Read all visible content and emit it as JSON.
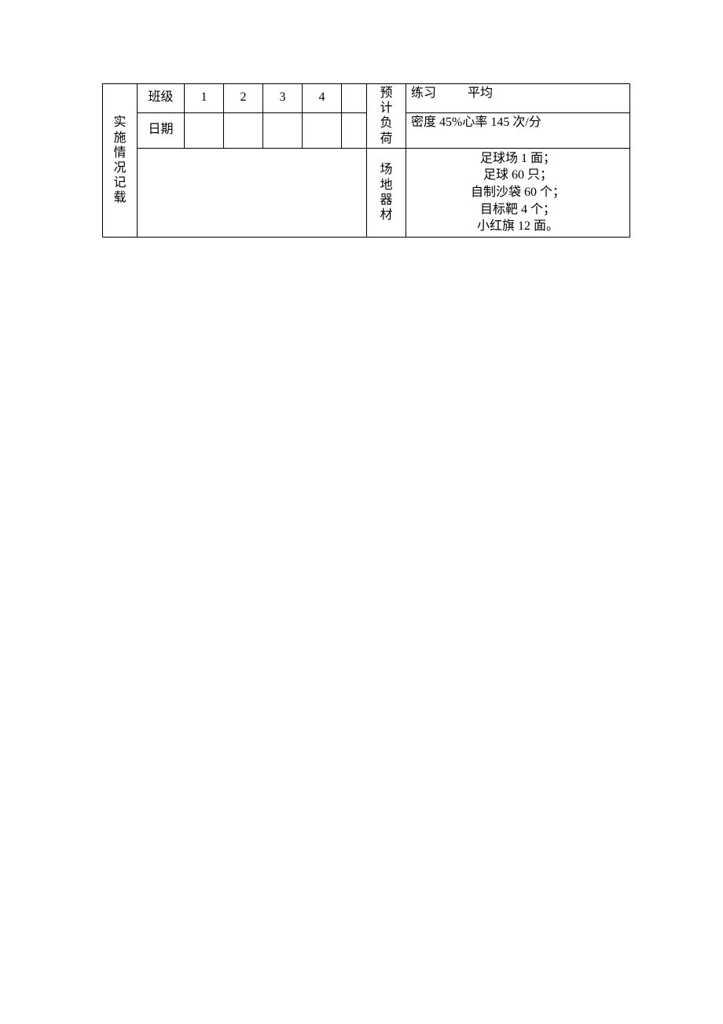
{
  "left_title": "实施情况记载",
  "row_class_label": "班级",
  "row_date_label": "日期",
  "class_nums": [
    "1",
    "2",
    "3",
    "4",
    ""
  ],
  "load_label": "预计负荷",
  "load_line1a": "练习",
  "load_line1b": "平均",
  "load_line2": "密度 45%心率 145 次/分",
  "equip_label": "场地器材",
  "equip_items": [
    "足球场 1 面；",
    "足球 60 只；",
    "自制沙袋 60 个；",
    "目标靶 4 个；",
    "小红旗 12 面。"
  ]
}
